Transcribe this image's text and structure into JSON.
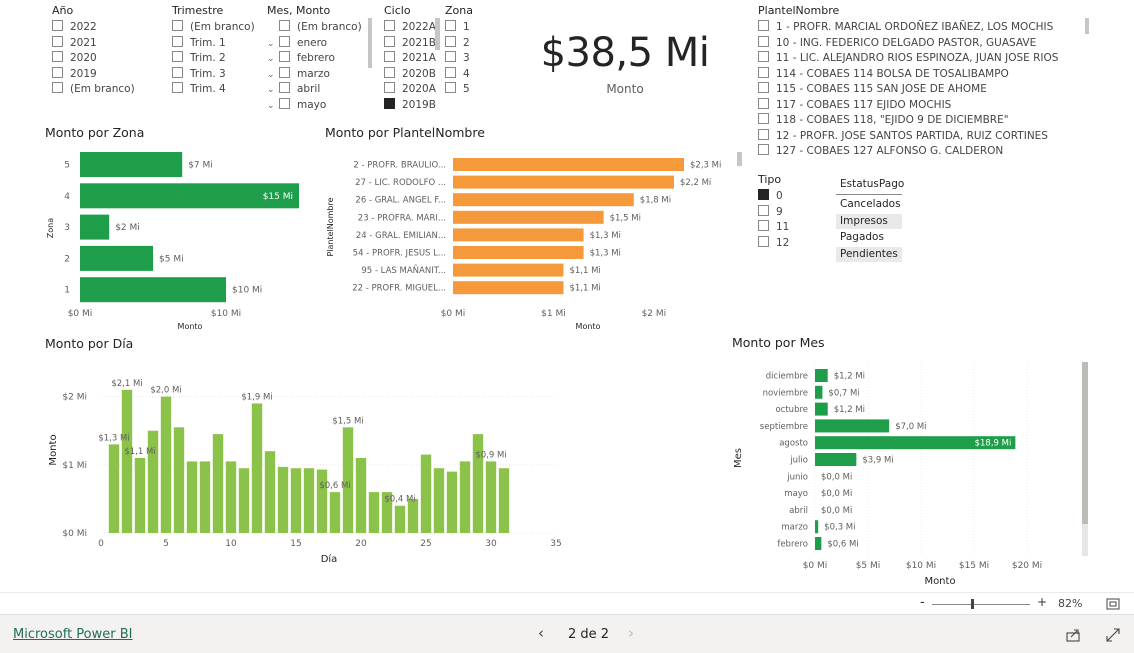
{
  "slicers": {
    "ano": {
      "title": "Año",
      "items": [
        "2022",
        "2021",
        "2020",
        "2019",
        "(Em branco)"
      ]
    },
    "trimestre": {
      "title": "Trimestre",
      "items": [
        "(Em branco)",
        "Trim. 1",
        "Trim. 2",
        "Trim. 3",
        "Trim. 4"
      ]
    },
    "mes": {
      "title": "Mes, Monto",
      "items": [
        "(Em branco)",
        "enero",
        "febrero",
        "marzo",
        "abril",
        "mayo"
      ]
    },
    "ciclo": {
      "title": "Ciclo",
      "items": [
        "2022A",
        "2021B",
        "2021A",
        "2020B",
        "2020A",
        "2019B"
      ],
      "selected": "2019B"
    },
    "zona": {
      "title": "Zona",
      "items": [
        "1",
        "2",
        "3",
        "4",
        "5"
      ]
    },
    "plantel": {
      "title": "PlantelNombre",
      "items": [
        "1 - PROFR. MARCIAL ORDOÑEZ IBAÑEZ, LOS MOCHIS",
        "10 - ING. FEDERICO DELGADO PASTOR, GUASAVE",
        "11 - LIC. ALEJANDRO RIOS ESPINOZA, JUAN JOSE RIOS",
        "114 - COBAES 114 BOLSA DE TOSALIBAMPO",
        "115 - COBAES 115 SAN JOSE DE AHOME",
        "117 - COBAES 117 EJIDO MOCHIS",
        "118 - COBAES 118, \"EJIDO 9 DE DICIEMBRE\"",
        "12 - PROFR. JOSE SANTOS PARTIDA, RUIZ CORTINES",
        "127 - COBAES 127 ALFONSO G. CALDERON"
      ]
    },
    "tipo": {
      "title": "Tipo",
      "items": [
        "0",
        "9",
        "11",
        "12"
      ],
      "selected": "0"
    },
    "estatus": {
      "title": "EstatusPago",
      "items": [
        "Cancelados",
        "Impresos",
        "Pagados",
        "Pendientes"
      ]
    }
  },
  "kpi": {
    "value": "$38,5 Mi",
    "label": "Monto"
  },
  "colors": {
    "green": "#1e9e4a",
    "orange": "#f5993a",
    "lightgreen": "#8bc34a"
  },
  "charts": {
    "zona": {
      "title": "Monto por Zona",
      "xlabel": "Monto",
      "ylabel": "Zona",
      "ticks": [
        "$0 Mi",
        "$10 Mi"
      ]
    },
    "plantel": {
      "title": "Monto por PlantelNombre",
      "xlabel": "Monto",
      "ylabel": "PlantelNombre",
      "ticks": [
        "$0 Mi",
        "$1 Mi",
        "$2 Mi"
      ]
    },
    "dia": {
      "title": "Monto por Día",
      "xlabel": "Día",
      "ylabel": "Monto",
      "yticks": [
        "$2 Mi",
        "$1 Mi",
        "$0 Mi"
      ],
      "xticks": [
        "0",
        "5",
        "10",
        "15",
        "20",
        "25",
        "30",
        "35"
      ]
    },
    "mes": {
      "title": "Monto por Mes",
      "xlabel": "Monto",
      "ylabel": "Mes",
      "ticks": [
        "$0 Mi",
        "$5 Mi",
        "$10 Mi",
        "$15 Mi",
        "$20 Mi"
      ]
    }
  },
  "chart_data": [
    {
      "type": "bar",
      "orientation": "horizontal",
      "title": "Monto por Zona",
      "xlabel": "Monto",
      "ylabel": "Zona",
      "categories": [
        "5",
        "4",
        "3",
        "2",
        "1"
      ],
      "values": [
        7,
        15,
        2,
        5,
        10
      ],
      "labels": [
        "$7 Mi",
        "$15 Mi",
        "$2 Mi",
        "$5 Mi",
        "$10 Mi"
      ],
      "xlim": [
        0,
        15
      ]
    },
    {
      "type": "bar",
      "orientation": "horizontal",
      "title": "Monto por PlantelNombre",
      "xlabel": "Monto",
      "ylabel": "PlantelNombre",
      "categories": [
        "2 - PROFR. BRAULIO...",
        "27 - LIC. RODOLFO ...",
        "26 - GRAL. ANGEL F...",
        "23 - PROFRA. MARI...",
        "24 - GRAL. EMILIAN...",
        "54 - PROFR. JESUS L...",
        "95 - LAS MAÑANIT...",
        "22 - PROFR. MIGUEL..."
      ],
      "values": [
        2.3,
        2.2,
        1.8,
        1.5,
        1.3,
        1.3,
        1.1,
        1.1
      ],
      "labels": [
        "$2,3 Mi",
        "$2,2 Mi",
        "$1,8 Mi",
        "$1,5 Mi",
        "$1,3 Mi",
        "$1,3 Mi",
        "$1,1 Mi",
        "$1,1 Mi"
      ],
      "xlim": [
        0,
        2.3
      ]
    },
    {
      "type": "bar",
      "title": "Monto por Día",
      "xlabel": "Día",
      "ylabel": "Monto",
      "x": [
        1,
        2,
        3,
        4,
        5,
        6,
        7,
        8,
        9,
        10,
        11,
        12,
        13,
        14,
        15,
        16,
        17,
        18,
        19,
        20,
        21,
        22,
        23,
        24,
        25,
        26,
        27,
        28,
        29,
        30,
        31
      ],
      "values": [
        1.3,
        2.1,
        1.1,
        1.5,
        2.0,
        1.55,
        1.05,
        1.05,
        1.45,
        1.05,
        0.95,
        1.9,
        1.2,
        0.97,
        0.95,
        0.95,
        0.93,
        0.6,
        1.55,
        1.1,
        0.6,
        0.6,
        0.4,
        0.5,
        1.15,
        0.95,
        0.9,
        1.05,
        1.45,
        1.05,
        0.95
      ],
      "data_labels": [
        {
          "x": 1,
          "text": "$1,3 Mi"
        },
        {
          "x": 2,
          "text": "$2,1 Mi"
        },
        {
          "x": 3,
          "text": "$1,1 Mi"
        },
        {
          "x": 5,
          "text": "$2,0 Mi"
        },
        {
          "x": 12,
          "text": "$1,9 Mi"
        },
        {
          "x": 18,
          "text": "$0,6 Mi"
        },
        {
          "x": 19,
          "text": "$1,5 Mi"
        },
        {
          "x": 23,
          "text": "$0,4 Mi"
        },
        {
          "x": 30,
          "text": "$0,9 Mi"
        }
      ],
      "xlim": [
        0,
        35
      ],
      "ylim": [
        0,
        2.2
      ]
    },
    {
      "type": "bar",
      "orientation": "horizontal",
      "title": "Monto por Mes",
      "xlabel": "Monto",
      "ylabel": "Mes",
      "categories": [
        "diciembre",
        "noviembre",
        "octubre",
        "septiembre",
        "agosto",
        "julio",
        "junio",
        "mayo",
        "abril",
        "marzo",
        "febrero"
      ],
      "values": [
        1.2,
        0.7,
        1.2,
        7.0,
        18.9,
        3.9,
        0.0,
        0.0,
        0.0,
        0.3,
        0.6
      ],
      "labels": [
        "$1,2 Mi",
        "$0,7 Mi",
        "$1,2 Mi",
        "$7,0 Mi",
        "$18,9 Mi",
        "$3,9 Mi",
        "$0,0 Mi",
        "$0,0 Mi",
        "$0,0 Mi",
        "$0,3 Mi",
        "$0,6 Mi"
      ],
      "xlim": [
        0,
        20
      ]
    }
  ],
  "footer": {
    "brand": "Microsoft Power BI",
    "page": "2 de 2",
    "zoom": "82%",
    "zoom_level": 0.82
  }
}
